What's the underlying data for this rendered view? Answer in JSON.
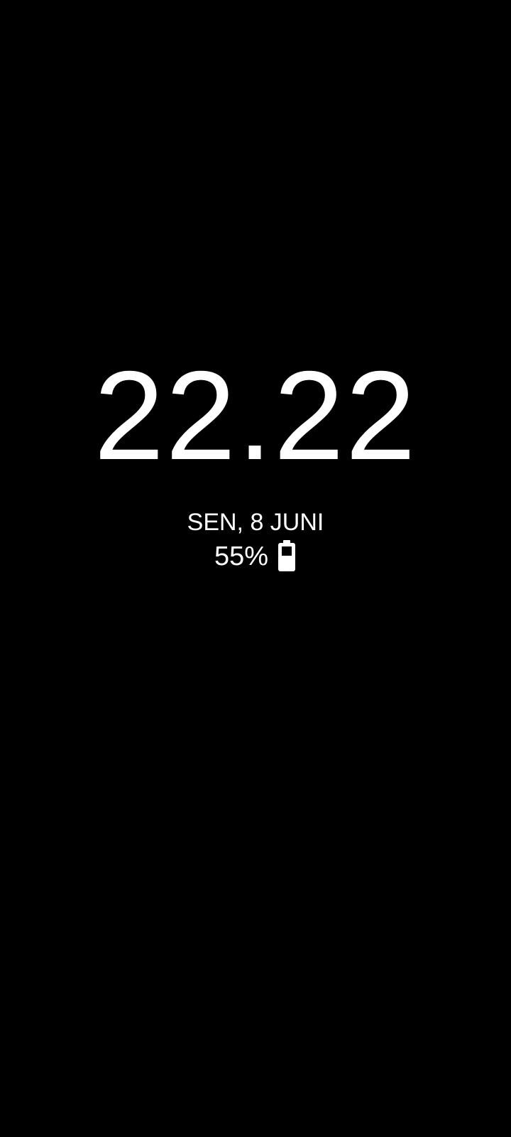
{
  "screen": {
    "background": "#000000",
    "foreground": "#ffffff"
  },
  "clock": {
    "time": "22.22"
  },
  "date": {
    "text": "SEN, 8 JUNI"
  },
  "battery": {
    "percent_label": "55%",
    "level": 0.55,
    "icon": "battery-icon"
  }
}
